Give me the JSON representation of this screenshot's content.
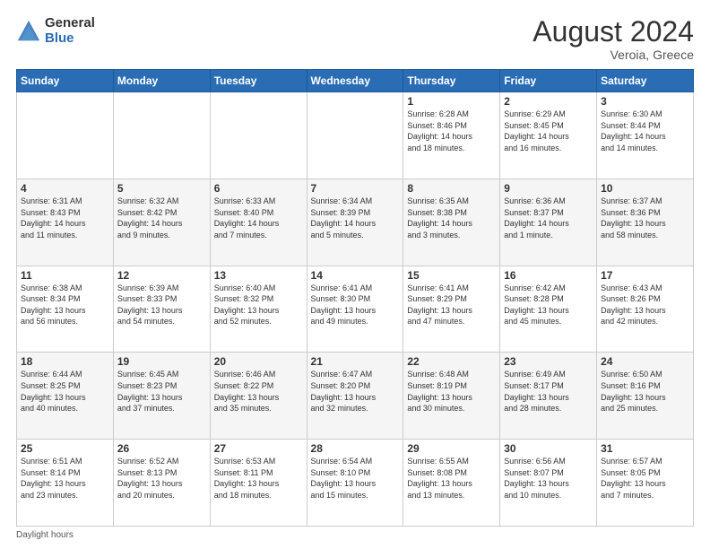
{
  "logo": {
    "general": "General",
    "blue": "Blue"
  },
  "title": {
    "month_year": "August 2024",
    "location": "Veroia, Greece"
  },
  "days_header": [
    "Sunday",
    "Monday",
    "Tuesday",
    "Wednesday",
    "Thursday",
    "Friday",
    "Saturday"
  ],
  "footer": {
    "daylight_label": "Daylight hours"
  },
  "weeks": [
    [
      {
        "day": "",
        "info": ""
      },
      {
        "day": "",
        "info": ""
      },
      {
        "day": "",
        "info": ""
      },
      {
        "day": "",
        "info": ""
      },
      {
        "day": "1",
        "info": "Sunrise: 6:28 AM\nSunset: 8:46 PM\nDaylight: 14 hours\nand 18 minutes."
      },
      {
        "day": "2",
        "info": "Sunrise: 6:29 AM\nSunset: 8:45 PM\nDaylight: 14 hours\nand 16 minutes."
      },
      {
        "day": "3",
        "info": "Sunrise: 6:30 AM\nSunset: 8:44 PM\nDaylight: 14 hours\nand 14 minutes."
      }
    ],
    [
      {
        "day": "4",
        "info": "Sunrise: 6:31 AM\nSunset: 8:43 PM\nDaylight: 14 hours\nand 11 minutes."
      },
      {
        "day": "5",
        "info": "Sunrise: 6:32 AM\nSunset: 8:42 PM\nDaylight: 14 hours\nand 9 minutes."
      },
      {
        "day": "6",
        "info": "Sunrise: 6:33 AM\nSunset: 8:40 PM\nDaylight: 14 hours\nand 7 minutes."
      },
      {
        "day": "7",
        "info": "Sunrise: 6:34 AM\nSunset: 8:39 PM\nDaylight: 14 hours\nand 5 minutes."
      },
      {
        "day": "8",
        "info": "Sunrise: 6:35 AM\nSunset: 8:38 PM\nDaylight: 14 hours\nand 3 minutes."
      },
      {
        "day": "9",
        "info": "Sunrise: 6:36 AM\nSunset: 8:37 PM\nDaylight: 14 hours\nand 1 minute."
      },
      {
        "day": "10",
        "info": "Sunrise: 6:37 AM\nSunset: 8:36 PM\nDaylight: 13 hours\nand 58 minutes."
      }
    ],
    [
      {
        "day": "11",
        "info": "Sunrise: 6:38 AM\nSunset: 8:34 PM\nDaylight: 13 hours\nand 56 minutes."
      },
      {
        "day": "12",
        "info": "Sunrise: 6:39 AM\nSunset: 8:33 PM\nDaylight: 13 hours\nand 54 minutes."
      },
      {
        "day": "13",
        "info": "Sunrise: 6:40 AM\nSunset: 8:32 PM\nDaylight: 13 hours\nand 52 minutes."
      },
      {
        "day": "14",
        "info": "Sunrise: 6:41 AM\nSunset: 8:30 PM\nDaylight: 13 hours\nand 49 minutes."
      },
      {
        "day": "15",
        "info": "Sunrise: 6:41 AM\nSunset: 8:29 PM\nDaylight: 13 hours\nand 47 minutes."
      },
      {
        "day": "16",
        "info": "Sunrise: 6:42 AM\nSunset: 8:28 PM\nDaylight: 13 hours\nand 45 minutes."
      },
      {
        "day": "17",
        "info": "Sunrise: 6:43 AM\nSunset: 8:26 PM\nDaylight: 13 hours\nand 42 minutes."
      }
    ],
    [
      {
        "day": "18",
        "info": "Sunrise: 6:44 AM\nSunset: 8:25 PM\nDaylight: 13 hours\nand 40 minutes."
      },
      {
        "day": "19",
        "info": "Sunrise: 6:45 AM\nSunset: 8:23 PM\nDaylight: 13 hours\nand 37 minutes."
      },
      {
        "day": "20",
        "info": "Sunrise: 6:46 AM\nSunset: 8:22 PM\nDaylight: 13 hours\nand 35 minutes."
      },
      {
        "day": "21",
        "info": "Sunrise: 6:47 AM\nSunset: 8:20 PM\nDaylight: 13 hours\nand 32 minutes."
      },
      {
        "day": "22",
        "info": "Sunrise: 6:48 AM\nSunset: 8:19 PM\nDaylight: 13 hours\nand 30 minutes."
      },
      {
        "day": "23",
        "info": "Sunrise: 6:49 AM\nSunset: 8:17 PM\nDaylight: 13 hours\nand 28 minutes."
      },
      {
        "day": "24",
        "info": "Sunrise: 6:50 AM\nSunset: 8:16 PM\nDaylight: 13 hours\nand 25 minutes."
      }
    ],
    [
      {
        "day": "25",
        "info": "Sunrise: 6:51 AM\nSunset: 8:14 PM\nDaylight: 13 hours\nand 23 minutes."
      },
      {
        "day": "26",
        "info": "Sunrise: 6:52 AM\nSunset: 8:13 PM\nDaylight: 13 hours\nand 20 minutes."
      },
      {
        "day": "27",
        "info": "Sunrise: 6:53 AM\nSunset: 8:11 PM\nDaylight: 13 hours\nand 18 minutes."
      },
      {
        "day": "28",
        "info": "Sunrise: 6:54 AM\nSunset: 8:10 PM\nDaylight: 13 hours\nand 15 minutes."
      },
      {
        "day": "29",
        "info": "Sunrise: 6:55 AM\nSunset: 8:08 PM\nDaylight: 13 hours\nand 13 minutes."
      },
      {
        "day": "30",
        "info": "Sunrise: 6:56 AM\nSunset: 8:07 PM\nDaylight: 13 hours\nand 10 minutes."
      },
      {
        "day": "31",
        "info": "Sunrise: 6:57 AM\nSunset: 8:05 PM\nDaylight: 13 hours\nand 7 minutes."
      }
    ]
  ]
}
